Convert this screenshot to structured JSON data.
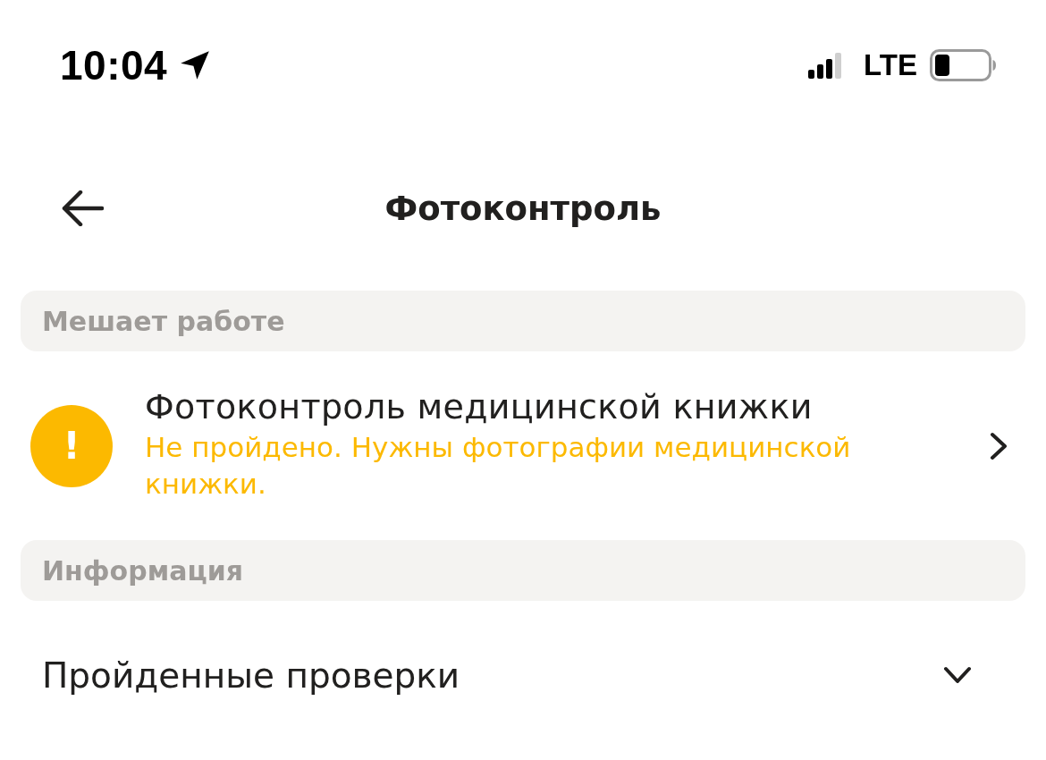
{
  "status_bar": {
    "time": "10:04",
    "network": "LTE"
  },
  "nav": {
    "title": "Фотоконтроль"
  },
  "sections": [
    {
      "header": "Мешает работе",
      "items": [
        {
          "kind": "check",
          "title": "Фотоконтроль медицинской книжки",
          "status": "Не пройдено. Нужны фотографии медицинской книжки.",
          "icon_text": "!",
          "color": "#fcb900"
        }
      ]
    },
    {
      "header": "Информация",
      "items": [
        {
          "kind": "expandable",
          "title": "Пройденные проверки",
          "expanded": false
        }
      ]
    }
  ]
}
